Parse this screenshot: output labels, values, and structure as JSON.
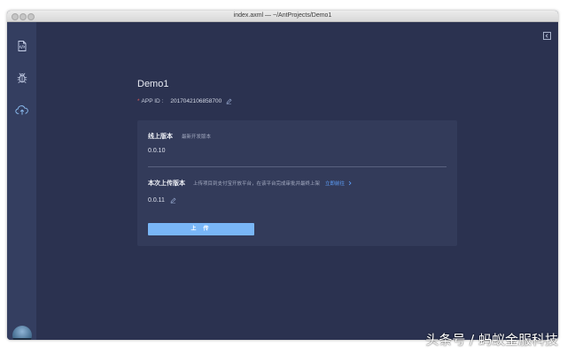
{
  "window": {
    "title": "index.axml — ~/AntProjects/Demo1"
  },
  "sidebar": {
    "items": [
      {
        "icon": "code-file-icon",
        "active": true
      },
      {
        "icon": "bug-icon",
        "active": false
      },
      {
        "icon": "cloud-upload-icon",
        "active": false
      }
    ],
    "avatar": "user-avatar"
  },
  "project": {
    "name": "Demo1",
    "app_id_label": "APP ID :",
    "app_id_required_mark": "*",
    "app_id_value": "2017042106858700"
  },
  "online_version": {
    "label": "线上版本",
    "hint": "最新开发版本",
    "value": "0.0.10"
  },
  "upload_version": {
    "label": "本次上传版本",
    "hint": "上传项目到支付宝开放平台，在该平台完成审批并最终上架",
    "link_label": "立即前往",
    "value": "0.0.11"
  },
  "upload_button": {
    "label": "上 传"
  },
  "watermark": {
    "text": "头条号 / 蚂蚁金服科技"
  },
  "colors": {
    "background": "#2b3250",
    "sidebar": "#343e60",
    "card": "#333b5a",
    "accent": "#79b6f7",
    "link": "#5ea2ff",
    "required": "#e05a5a"
  }
}
